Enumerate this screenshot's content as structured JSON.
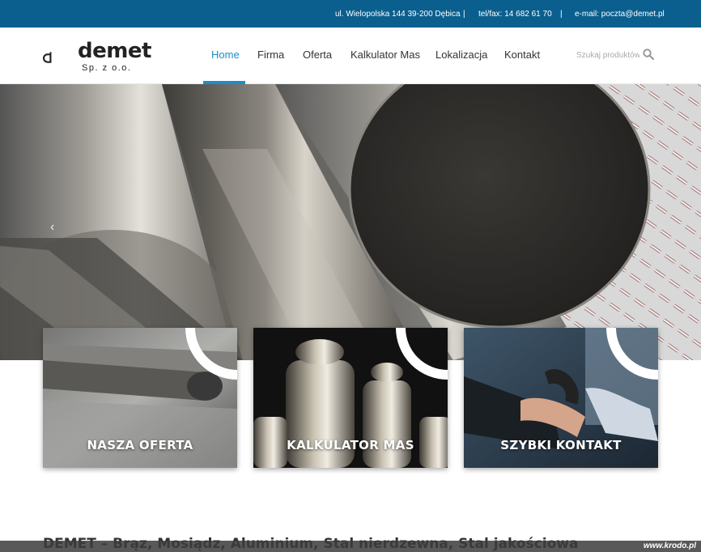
{
  "topbar": {
    "address": "ul. Wielopolska 144 39-200 Dębica",
    "separator": "|",
    "phone": "tel/fax: 14 682 61 70",
    "email": "e-mail: poczta@demet.pl"
  },
  "logo": {
    "name": "demet",
    "subtitle": "Sp. z o.o."
  },
  "nav": {
    "items": [
      "Home",
      "Firma",
      "Oferta",
      "Kalkulator Mas",
      "Lokalizacja",
      "Kontakt"
    ],
    "active": "Home"
  },
  "search": {
    "placeholder": "Szukaj produktów"
  },
  "hero": {
    "prev_arrow": "‹"
  },
  "cards": [
    {
      "label": "NASZA OFERTA"
    },
    {
      "label": "KALKULATOR MAS"
    },
    {
      "label": "SZYBKI KONTAKT"
    }
  ],
  "main": {
    "heading": "DEMET – Brąz, Mosiądz, Aluminium, Stal nierdzewna, Stal jakościowa"
  },
  "watermark": "www.krodo.pl",
  "colors": {
    "topbar_bg": "#0a5f8e",
    "accent": "#1a8ec8",
    "text": "#333333"
  }
}
